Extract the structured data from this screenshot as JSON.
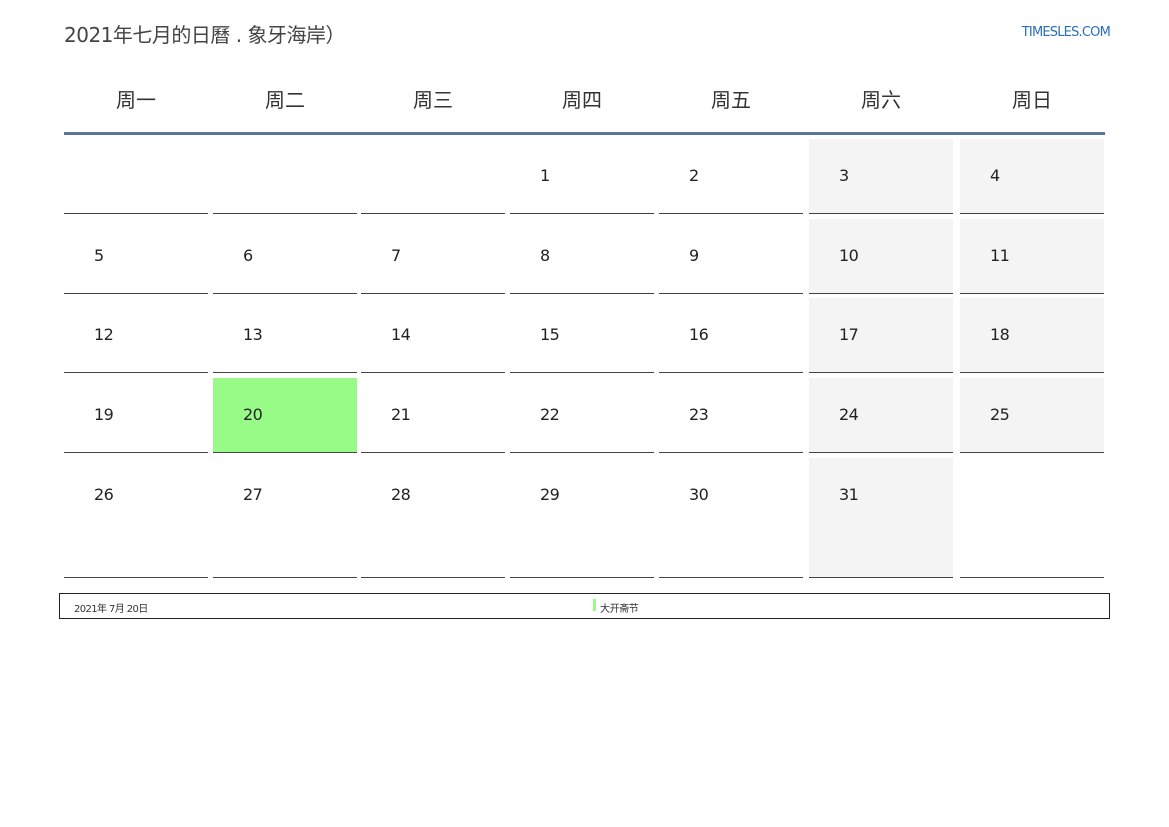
{
  "title": "2021年七月的日曆 . 象牙海岸）",
  "site": "TIMESLES.COM",
  "weekdays": [
    "周一",
    "周二",
    "周三",
    "周四",
    "周五",
    "周六",
    "周日"
  ],
  "weeks": [
    [
      "",
      "",
      "",
      "1",
      "2",
      "3",
      "4"
    ],
    [
      "5",
      "6",
      "7",
      "8",
      "9",
      "10",
      "11"
    ],
    [
      "12",
      "13",
      "14",
      "15",
      "16",
      "17",
      "18"
    ],
    [
      "19",
      "20",
      "21",
      "22",
      "23",
      "24",
      "25"
    ],
    [
      "26",
      "27",
      "28",
      "29",
      "30",
      "31",
      ""
    ]
  ],
  "highlight_day": "20",
  "legend": {
    "date": "2021年 7月 20日",
    "holiday": "大开斋节"
  },
  "colors": {
    "highlight": "#98fb87",
    "weekend_bg": "#f4f4f4",
    "header_rule": "#5a7597",
    "site_link": "#2a6ebb"
  }
}
